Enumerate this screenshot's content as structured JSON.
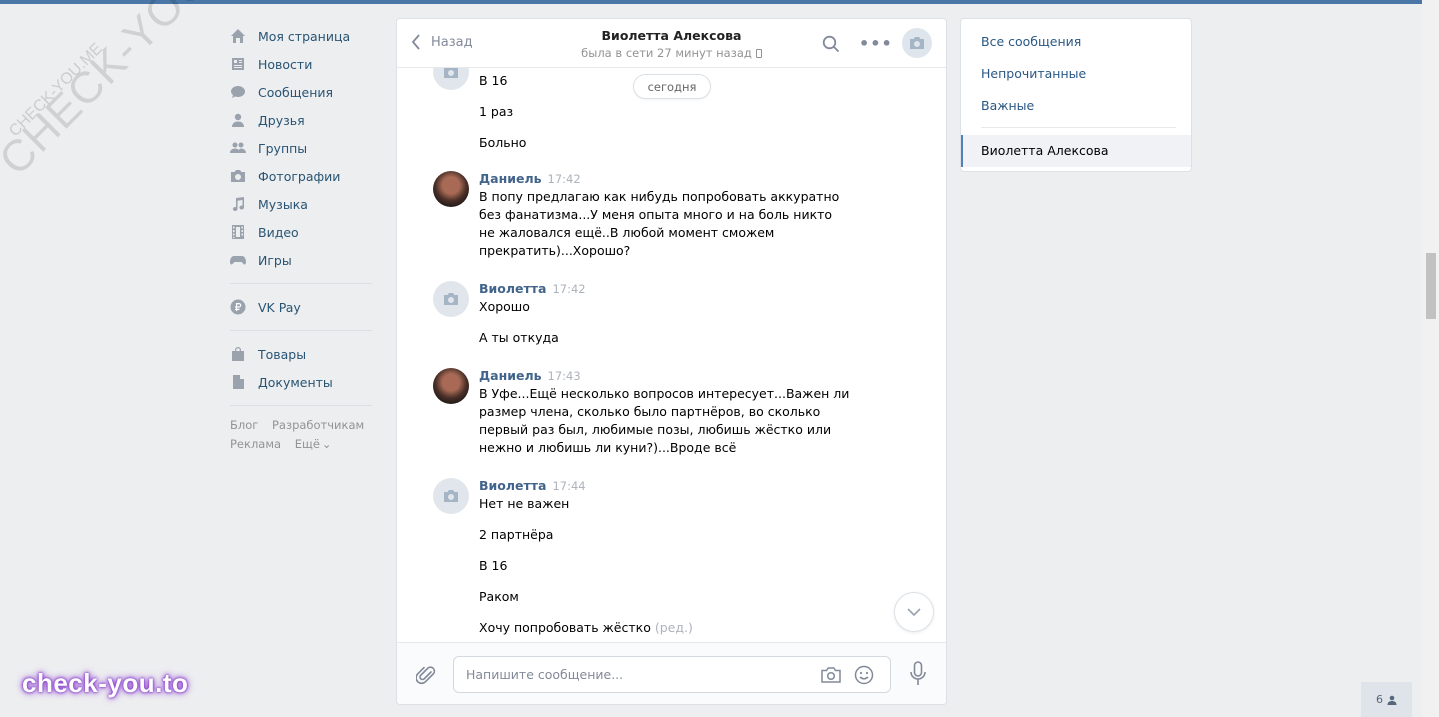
{
  "watermark": {
    "big": "CHECK-YOU.ME",
    "small": "CHECK-YOU.ME",
    "bottom": "check-you.to"
  },
  "nav": {
    "items": [
      {
        "label": "Моя страница",
        "icon": "home-icon"
      },
      {
        "label": "Новости",
        "icon": "news-icon"
      },
      {
        "label": "Сообщения",
        "icon": "messages-icon"
      },
      {
        "label": "Друзья",
        "icon": "friends-icon"
      },
      {
        "label": "Группы",
        "icon": "groups-icon"
      },
      {
        "label": "Фотографии",
        "icon": "photos-icon"
      },
      {
        "label": "Музыка",
        "icon": "music-icon"
      },
      {
        "label": "Видео",
        "icon": "video-icon"
      },
      {
        "label": "Игры",
        "icon": "games-icon"
      }
    ],
    "pay": {
      "label": "VK Pay",
      "icon": "vkpay-icon"
    },
    "extra": [
      {
        "label": "Товары",
        "icon": "goods-icon"
      },
      {
        "label": "Документы",
        "icon": "documents-icon"
      }
    ],
    "footer": {
      "blog": "Блог",
      "dev": "Разработчикам",
      "ads": "Реклама",
      "more": "Ещё"
    }
  },
  "chat": {
    "back_label": "Назад",
    "title": "Виолетта Алексова",
    "status": "была в сети 27 минут назад",
    "date_pill": "сегодня",
    "messages": {
      "g0": {
        "lines": [
          "В 16",
          "1 раз",
          "Больно"
        ]
      },
      "g1": {
        "author": "Даниель",
        "time": "17:42",
        "text": "В попу предлагаю как нибудь попробовать аккуратно без фанатизма...У меня опыта много и на боль никто не жаловался ещё..В любой момент сможем прекратить)...Хорошо?"
      },
      "g2": {
        "author": "Виолетта",
        "time": "17:42",
        "lines": [
          "Хорошо",
          "А ты откуда"
        ]
      },
      "g3": {
        "author": "Даниель",
        "time": "17:43",
        "text": "В Уфе...Ещё несколько вопросов интересует...Важен ли размер члена, сколько было партнёров, во сколько первый раз был, любимые позы, любишь жёстко или нежно и любишь ли куни?)...Вроде всё"
      },
      "g4": {
        "author": "Виолетта",
        "time": "17:44",
        "lines": [
          "Нет не важен",
          "2 партнёра",
          "В 16",
          "Раком",
          "Хочу попробовать жёстко"
        ],
        "edited": "(ред.)"
      }
    },
    "composer_placeholder": "Напишите сообщение..."
  },
  "right_panel": {
    "all": "Все сообщения",
    "unread": "Непрочитанные",
    "important": "Важные",
    "selected_chat": "Виолетта Алексова"
  },
  "online_count": "6"
}
